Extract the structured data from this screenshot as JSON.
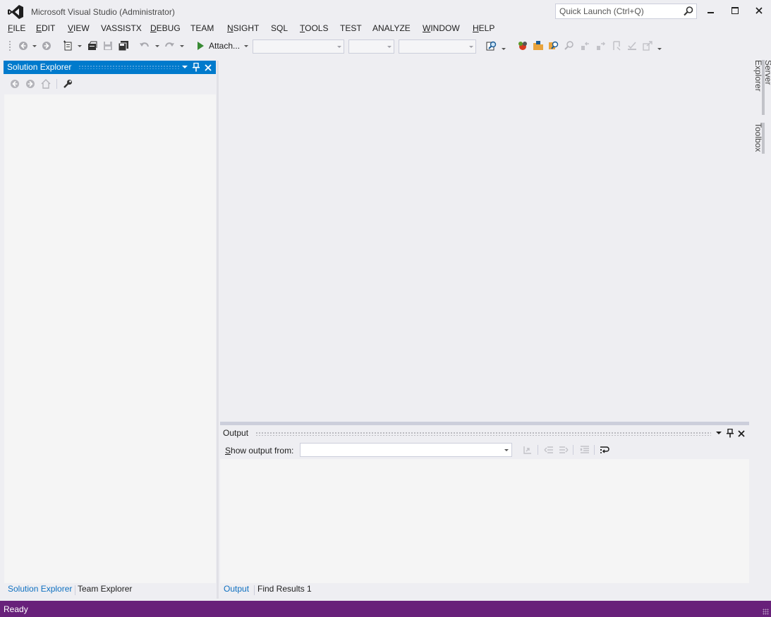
{
  "window": {
    "title": "Microsoft Visual Studio (Administrator)",
    "quick_launch_placeholder": "Quick Launch (Ctrl+Q)"
  },
  "menu": [
    {
      "label": "FILE",
      "mnemonic": "F",
      "rest": "ILE"
    },
    {
      "label": "EDIT",
      "mnemonic": "E",
      "rest": "DIT"
    },
    {
      "label": "VIEW",
      "mnemonic": "V",
      "rest": "IEW"
    },
    {
      "label": "VASSISTX",
      "mnemonic": "",
      "rest": "VASSISTX"
    },
    {
      "label": "DEBUG",
      "mnemonic": "D",
      "rest": "EBUG"
    },
    {
      "label": "TEAM",
      "mnemonic": "",
      "rest": "TEAM"
    },
    {
      "label": "NSIGHT",
      "mnemonic": "N",
      "rest": "SIGHT"
    },
    {
      "label": "SQL",
      "mnemonic": "",
      "rest": "SQL"
    },
    {
      "label": "TOOLS",
      "mnemonic": "T",
      "rest": "OOLS"
    },
    {
      "label": "TEST",
      "mnemonic": "",
      "rest": "TEST"
    },
    {
      "label": "ANALYZE",
      "mnemonic": "",
      "rest": "ANALYZE"
    },
    {
      "label": "WINDOW",
      "mnemonic": "W",
      "rest": "INDOW"
    },
    {
      "label": "HELP",
      "mnemonic": "H",
      "rest": "ELP"
    }
  ],
  "toolbar": {
    "attach_label": "Attach...",
    "solution_config_value": "",
    "solution_platform_value": "",
    "find_value": ""
  },
  "solution_explorer": {
    "title": "Solution Explorer",
    "bottom_tabs": [
      "Solution Explorer",
      "Team Explorer"
    ]
  },
  "output": {
    "title": "Output",
    "show_from_label": "Show output from:",
    "show_from_mnemonic": "S",
    "show_from_rest": "how output from:",
    "source_value": "",
    "bottom_tabs": [
      "Output",
      "Find Results 1"
    ]
  },
  "side_tabs": [
    "Server Explorer",
    "Toolbox"
  ],
  "status": {
    "text": "Ready",
    "bar_color": "#68217a"
  },
  "colors": {
    "accent": "#007acc",
    "status": "#68217a",
    "run_green": "#388a34"
  }
}
